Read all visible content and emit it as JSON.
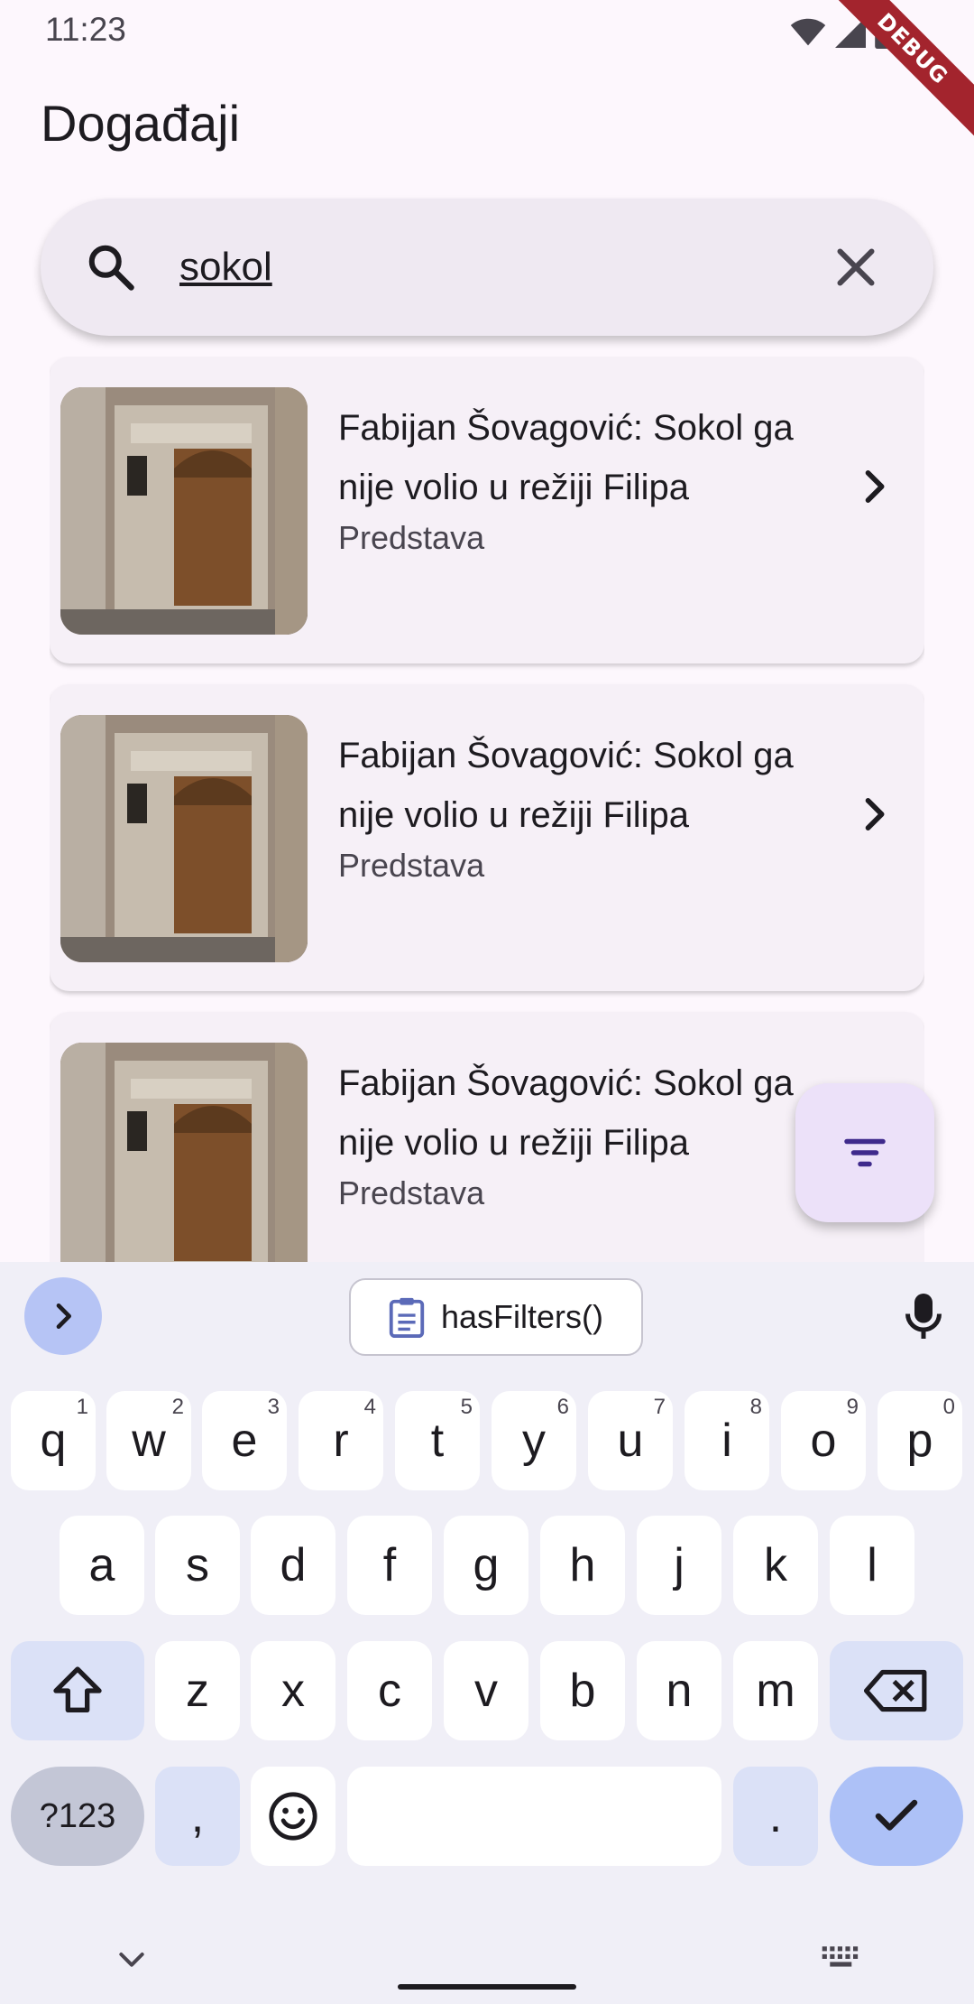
{
  "status_bar": {
    "time": "11:23",
    "debug_label": "DEBUG"
  },
  "page": {
    "title": "Događaji"
  },
  "search": {
    "value": "sokol",
    "icon": "search-icon",
    "clear_icon": "close-icon"
  },
  "events": [
    {
      "title": "Fabijan Šovagović: Sokol ga nije volio u režiji Filipa",
      "category": "Predstava"
    },
    {
      "title": "Fabijan Šovagović: Sokol ga nije volio u režiji Filipa",
      "category": "Predstava"
    },
    {
      "title": "Fabijan Šovagović: Sokol ga nije volio u režiji Filipa",
      "category": "Predstava"
    }
  ],
  "fab": {
    "icon": "filter-icon"
  },
  "keyboard": {
    "suggestion": "hasFilters()",
    "row1": [
      {
        "key": "q",
        "hint": "1"
      },
      {
        "key": "w",
        "hint": "2"
      },
      {
        "key": "e",
        "hint": "3"
      },
      {
        "key": "r",
        "hint": "4"
      },
      {
        "key": "t",
        "hint": "5"
      },
      {
        "key": "y",
        "hint": "6"
      },
      {
        "key": "u",
        "hint": "7"
      },
      {
        "key": "i",
        "hint": "8"
      },
      {
        "key": "o",
        "hint": "9"
      },
      {
        "key": "p",
        "hint": "0"
      }
    ],
    "row2": [
      "a",
      "s",
      "d",
      "f",
      "g",
      "h",
      "j",
      "k",
      "l"
    ],
    "row3": [
      "z",
      "x",
      "c",
      "v",
      "b",
      "n",
      "m"
    ],
    "symbols_label": "?123",
    "comma": ",",
    "period": "."
  },
  "colors": {
    "background": "#fdf7fd",
    "search_bg": "#efe9f2",
    "card_bg": "#f6f0f7",
    "fab_bg": "#ece1f9",
    "accent": "#3f2a8c",
    "debug_ribbon": "#a3242d"
  }
}
